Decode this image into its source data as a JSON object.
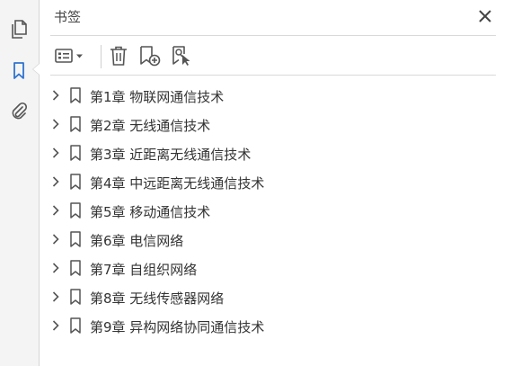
{
  "panel": {
    "title": "书签"
  },
  "toolbar": {
    "options_icon": "list-options-icon",
    "delete_icon": "trash-icon",
    "new_bookmark_icon": "bookmark-add-icon",
    "find_bookmark_icon": "bookmark-find-icon"
  },
  "bookmarks": [
    {
      "label": "第1章  物联网通信技术"
    },
    {
      "label": "第2章  无线通信技术"
    },
    {
      "label": "第3章  近距离无线通信技术"
    },
    {
      "label": "第4章  中远距离无线通信技术"
    },
    {
      "label": "第5章  移动通信技术"
    },
    {
      "label": "第6章  电信网络"
    },
    {
      "label": "第7章  自组织网络"
    },
    {
      "label": "第8章  无线传感器网络"
    },
    {
      "label": "第9章  异构网络协同通信技术"
    }
  ],
  "colors": {
    "accent": "#2f73d0",
    "icon": "#555555",
    "rail_bg": "#f4f4f4"
  }
}
